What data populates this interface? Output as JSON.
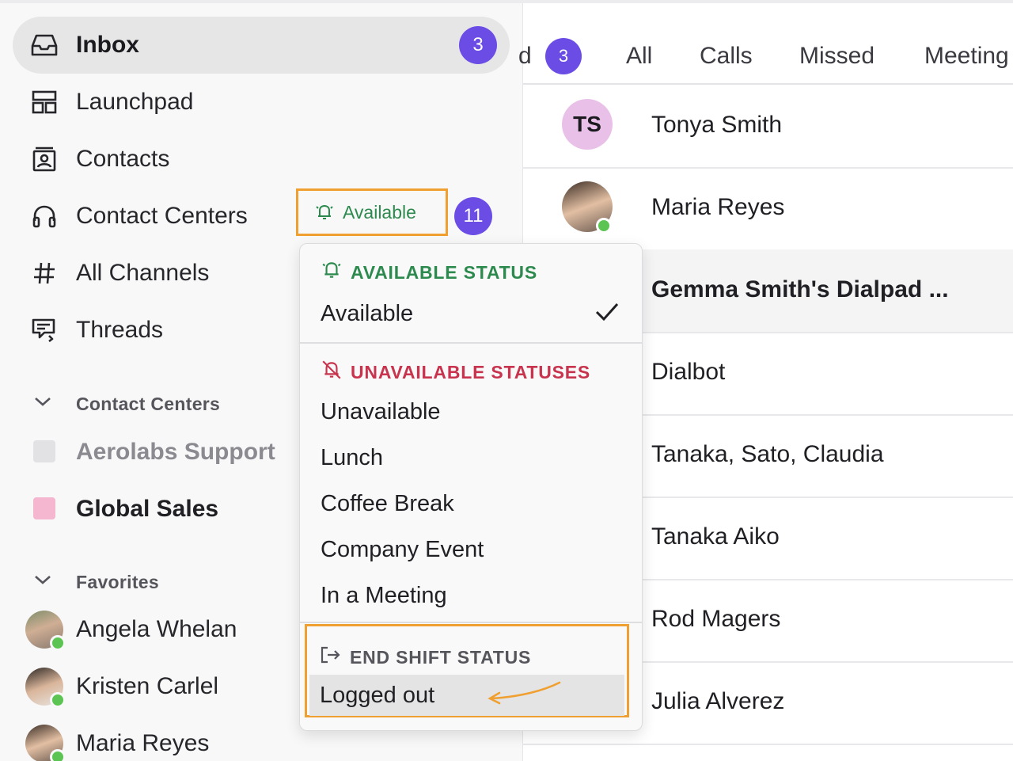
{
  "sidebar": {
    "inbox": {
      "label": "Inbox",
      "count": "3"
    },
    "launchpad": {
      "label": "Launchpad"
    },
    "contacts": {
      "label": "Contacts"
    },
    "contact_centers": {
      "label": "Contact Centers",
      "status": "Available",
      "count": "11"
    },
    "all_channels": {
      "label": "All Channels"
    },
    "threads": {
      "label": "Threads"
    },
    "cc_section": {
      "title": "Contact Centers",
      "items": [
        {
          "label": "Aerolabs Support",
          "color": "#e2e2e4",
          "text_color": "#8a8a90"
        },
        {
          "label": "Global Sales",
          "color": "#f5b6cf",
          "text_color": "#1f1f24"
        }
      ]
    },
    "favorites": {
      "title": "Favorites",
      "items": [
        {
          "label": "Angela Whelan",
          "online": true
        },
        {
          "label": "Kristen Carlel",
          "online": true
        },
        {
          "label": "Maria Reyes",
          "online": true
        }
      ]
    }
  },
  "main": {
    "tabs": {
      "partial_label": "d",
      "partial_count": "3",
      "all": "All",
      "calls": "Calls",
      "missed": "Missed",
      "meetings": "Meeting"
    },
    "rows": [
      {
        "name": "Tonya Smith",
        "initials": "TS"
      },
      {
        "name": "Maria Reyes",
        "online": true
      },
      {
        "name": "Gemma Smith's Dialpad ...",
        "bold": true
      },
      {
        "name": "Dialbot"
      },
      {
        "name": "Tanaka, Sato, Claudia"
      },
      {
        "name": "Tanaka Aiko"
      },
      {
        "name": "Rod Magers"
      },
      {
        "name": "Julia Alverez"
      }
    ]
  },
  "dropdown": {
    "available_header": "AVAILABLE STATUS",
    "available_item": "Available",
    "unavailable_header": "UNAVAILABLE STATUSES",
    "unavailable_items": [
      "Unavailable",
      "Lunch",
      "Coffee Break",
      "Company Event",
      "In a Meeting"
    ],
    "end_shift_header": "END SHIFT STATUS",
    "end_shift_item": "Logged out"
  },
  "colors": {
    "badge": "#6b4de6",
    "available_green": "#2d8a4e",
    "unavailable_red": "#c8334e",
    "annotation_orange": "#f0a030",
    "ts_avatar": "#e9c1e8"
  }
}
